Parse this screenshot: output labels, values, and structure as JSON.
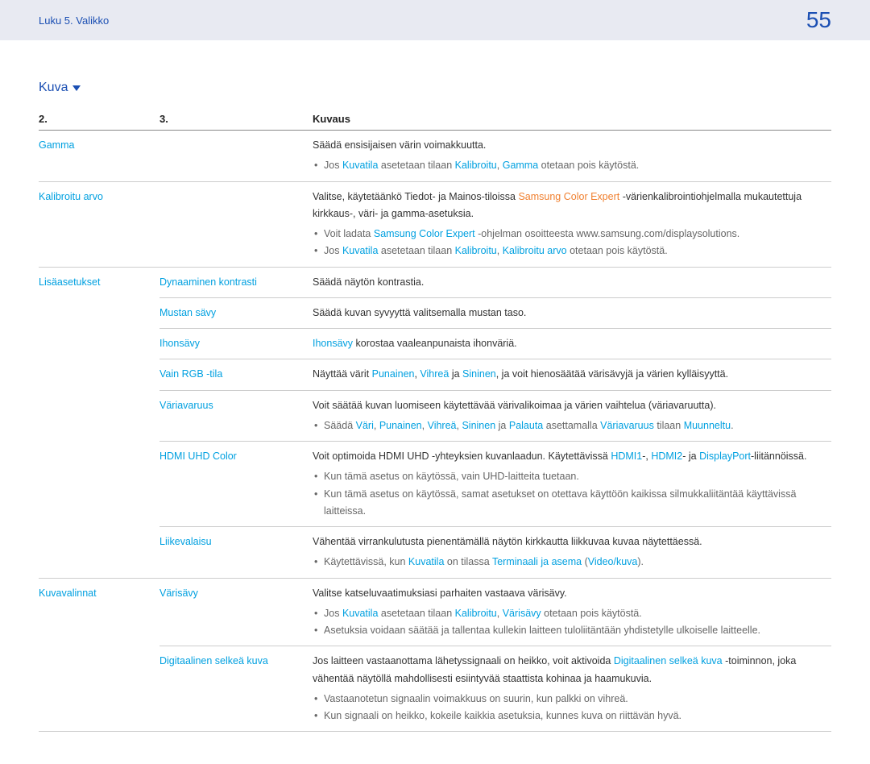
{
  "header": {
    "chapter": "Luku 5. Valikko",
    "page": "55"
  },
  "section": {
    "title": "Kuva"
  },
  "table": {
    "headers": {
      "c1": "2.",
      "c2": "3.",
      "c3": "Kuvaus"
    },
    "rows": [
      {
        "c1": "Gamma",
        "c2": "",
        "desc": "Säädä ensisijaisen värin voimakkuutta.",
        "bullets": [
          {
            "segs": [
              {
                "t": "Jos "
              },
              {
                "t": "Kuvatila",
                "c": "blue"
              },
              {
                "t": " asetetaan tilaan "
              },
              {
                "t": "Kalibroitu",
                "c": "blue"
              },
              {
                "t": ", "
              },
              {
                "t": "Gamma",
                "c": "blue"
              },
              {
                "t": " otetaan pois käytöstä."
              }
            ]
          }
        ]
      },
      {
        "c1": "Kalibroitu arvo",
        "c2": "",
        "desc_segs": [
          {
            "t": "Valitse, käytetäänkö Tiedot- ja Mainos-tiloissa "
          },
          {
            "t": "Samsung Color Expert",
            "c": "orange"
          },
          {
            "t": " -värienkalibrointiohjelmalla mukautettuja kirkkaus-, väri- ja gamma-asetuksia."
          }
        ],
        "bullets": [
          {
            "segs": [
              {
                "t": "Voit ladata "
              },
              {
                "t": "Samsung Color Expert",
                "c": "blue"
              },
              {
                "t": " -ohjelman osoitteesta www.samsung.com/displaysolutions."
              }
            ]
          },
          {
            "segs": [
              {
                "t": "Jos "
              },
              {
                "t": "Kuvatila",
                "c": "blue"
              },
              {
                "t": " asetetaan tilaan "
              },
              {
                "t": "Kalibroitu",
                "c": "blue"
              },
              {
                "t": ", "
              },
              {
                "t": "Kalibroitu arvo",
                "c": "blue"
              },
              {
                "t": " otetaan pois käytöstä."
              }
            ]
          }
        ]
      },
      {
        "c1": "Lisäasetukset",
        "c2": "Dynaaminen kontrasti",
        "desc": "Säädä näytön kontrastia."
      },
      {
        "c1": "",
        "c2": "Mustan sävy",
        "desc": "Säädä kuvan syvyyttä valitsemalla mustan taso."
      },
      {
        "c1": "",
        "c2": "Ihonsävy",
        "desc_segs": [
          {
            "t": "Ihonsävy",
            "c": "blue"
          },
          {
            "t": " korostaa vaaleanpunaista ihonväriä."
          }
        ]
      },
      {
        "c1": "",
        "c2": "Vain RGB -tila",
        "desc_segs": [
          {
            "t": "Näyttää värit "
          },
          {
            "t": "Punainen",
            "c": "blue"
          },
          {
            "t": ", "
          },
          {
            "t": "Vihreä",
            "c": "blue"
          },
          {
            "t": " ja "
          },
          {
            "t": "Sininen",
            "c": "blue"
          },
          {
            "t": ", ja voit hienosäätää värisävyjä ja värien kylläisyyttä."
          }
        ]
      },
      {
        "c1": "",
        "c2": "Väriavaruus",
        "desc": "Voit säätää kuvan luomiseen käytettävää värivalikoimaa ja värien vaihtelua (väriavaruutta).",
        "bullets": [
          {
            "segs": [
              {
                "t": "Säädä "
              },
              {
                "t": "Väri",
                "c": "blue"
              },
              {
                "t": ", "
              },
              {
                "t": "Punainen",
                "c": "blue"
              },
              {
                "t": ", "
              },
              {
                "t": "Vihreä",
                "c": "blue"
              },
              {
                "t": ", "
              },
              {
                "t": "Sininen",
                "c": "blue"
              },
              {
                "t": " ja "
              },
              {
                "t": "Palauta",
                "c": "blue"
              },
              {
                "t": " asettamalla "
              },
              {
                "t": "Väriavaruus",
                "c": "blue"
              },
              {
                "t": " tilaan "
              },
              {
                "t": "Muunneltu",
                "c": "blue"
              },
              {
                "t": "."
              }
            ]
          }
        ]
      },
      {
        "c1": "",
        "c2": "HDMI UHD Color",
        "desc_segs": [
          {
            "t": "Voit optimoida HDMI UHD -yhteyksien kuvanlaadun. Käytettävissä "
          },
          {
            "t": "HDMI1",
            "c": "blue"
          },
          {
            "t": "-, "
          },
          {
            "t": "HDMI2",
            "c": "blue"
          },
          {
            "t": "- ja "
          },
          {
            "t": "DisplayPort",
            "c": "blue"
          },
          {
            "t": "-liitännöissä."
          }
        ],
        "bullets": [
          {
            "segs": [
              {
                "t": "Kun tämä asetus on käytössä, vain UHD-laitteita tuetaan."
              }
            ]
          },
          {
            "segs": [
              {
                "t": "Kun tämä asetus on käytössä, samat asetukset on otettava käyttöön kaikissa silmukkaliitäntää käyttävissä laitteissa."
              }
            ]
          }
        ]
      },
      {
        "c1": "",
        "c2": "Liikevalaisu",
        "desc": "Vähentää virrankulutusta pienentämällä näytön kirkkautta liikkuvaa kuvaa näytettäessä.",
        "bullets": [
          {
            "segs": [
              {
                "t": "Käytettävissä, kun "
              },
              {
                "t": "Kuvatila",
                "c": "blue"
              },
              {
                "t": " on tilassa "
              },
              {
                "t": "Terminaali ja asema",
                "c": "blue"
              },
              {
                "t": " ("
              },
              {
                "t": "Video/kuva",
                "c": "blue"
              },
              {
                "t": ")."
              }
            ]
          }
        ]
      },
      {
        "c1": "Kuvavalinnat",
        "c2": "Värisävy",
        "desc": "Valitse katseluvaatimuksiasi parhaiten vastaava värisävy.",
        "bullets": [
          {
            "segs": [
              {
                "t": "Jos "
              },
              {
                "t": "Kuvatila",
                "c": "blue"
              },
              {
                "t": " asetetaan tilaan "
              },
              {
                "t": "Kalibroitu",
                "c": "blue"
              },
              {
                "t": ", "
              },
              {
                "t": "Värisävy",
                "c": "blue"
              },
              {
                "t": " otetaan pois käytöstä."
              }
            ]
          },
          {
            "segs": [
              {
                "t": "Asetuksia voidaan säätää ja tallentaa kullekin laitteen tuloliitäntään yhdistetylle ulkoiselle laitteelle."
              }
            ]
          }
        ]
      },
      {
        "c1": "",
        "c2": "Digitaalinen selkeä kuva",
        "desc_segs": [
          {
            "t": "Jos laitteen vastaanottama lähetyssignaali on heikko, voit aktivoida "
          },
          {
            "t": "Digitaalinen selkeä kuva",
            "c": "blue"
          },
          {
            "t": " -toiminnon, joka vähentää näytöllä mahdollisesti esiintyvää staattista kohinaa ja haamukuvia."
          }
        ],
        "bullets": [
          {
            "segs": [
              {
                "t": "Vastaanotetun signaalin voimakkuus on suurin, kun palkki on vihreä."
              }
            ]
          },
          {
            "segs": [
              {
                "t": "Kun signaali on heikko, kokeile kaikkia asetuksia, kunnes kuva on riittävän hyvä."
              }
            ]
          }
        ]
      }
    ]
  }
}
